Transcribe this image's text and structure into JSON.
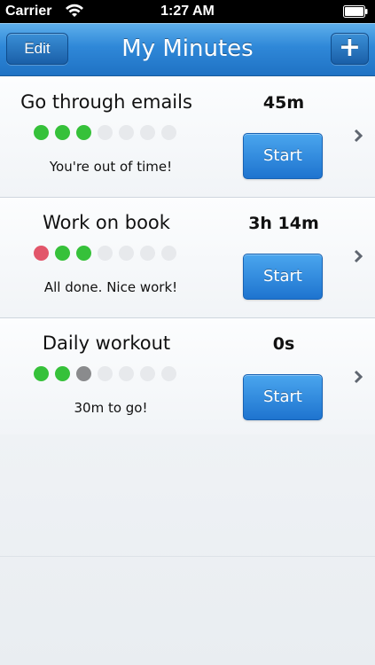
{
  "status_bar": {
    "carrier": "Carrier",
    "time": "1:27 AM"
  },
  "nav": {
    "title": "My Minutes",
    "edit_label": "Edit",
    "add_label": "+"
  },
  "tasks": [
    {
      "name": "Go through emails",
      "time": "45m",
      "start_label": "Start",
      "status": "You're out of time!",
      "dots": [
        "green",
        "green",
        "green",
        "empty",
        "empty",
        "empty",
        "empty"
      ]
    },
    {
      "name": "Work on book",
      "time": "3h 14m",
      "start_label": "Start",
      "status": "All done. Nice work!",
      "dots": [
        "red",
        "green",
        "green",
        "empty",
        "empty",
        "empty",
        "empty"
      ]
    },
    {
      "name": "Daily workout",
      "time": "0s",
      "start_label": "Start",
      "status": "30m to go!",
      "dots": [
        "green",
        "green",
        "gray",
        "empty",
        "empty",
        "empty",
        "empty"
      ]
    }
  ],
  "colors": {
    "nav_blue": "#2f88d8",
    "button_blue": "#1e74cf",
    "dot_green": "#36c13a",
    "dot_red": "#e2566a",
    "dot_gray": "#8a8b8d",
    "dot_empty": "#e7e9ec"
  }
}
